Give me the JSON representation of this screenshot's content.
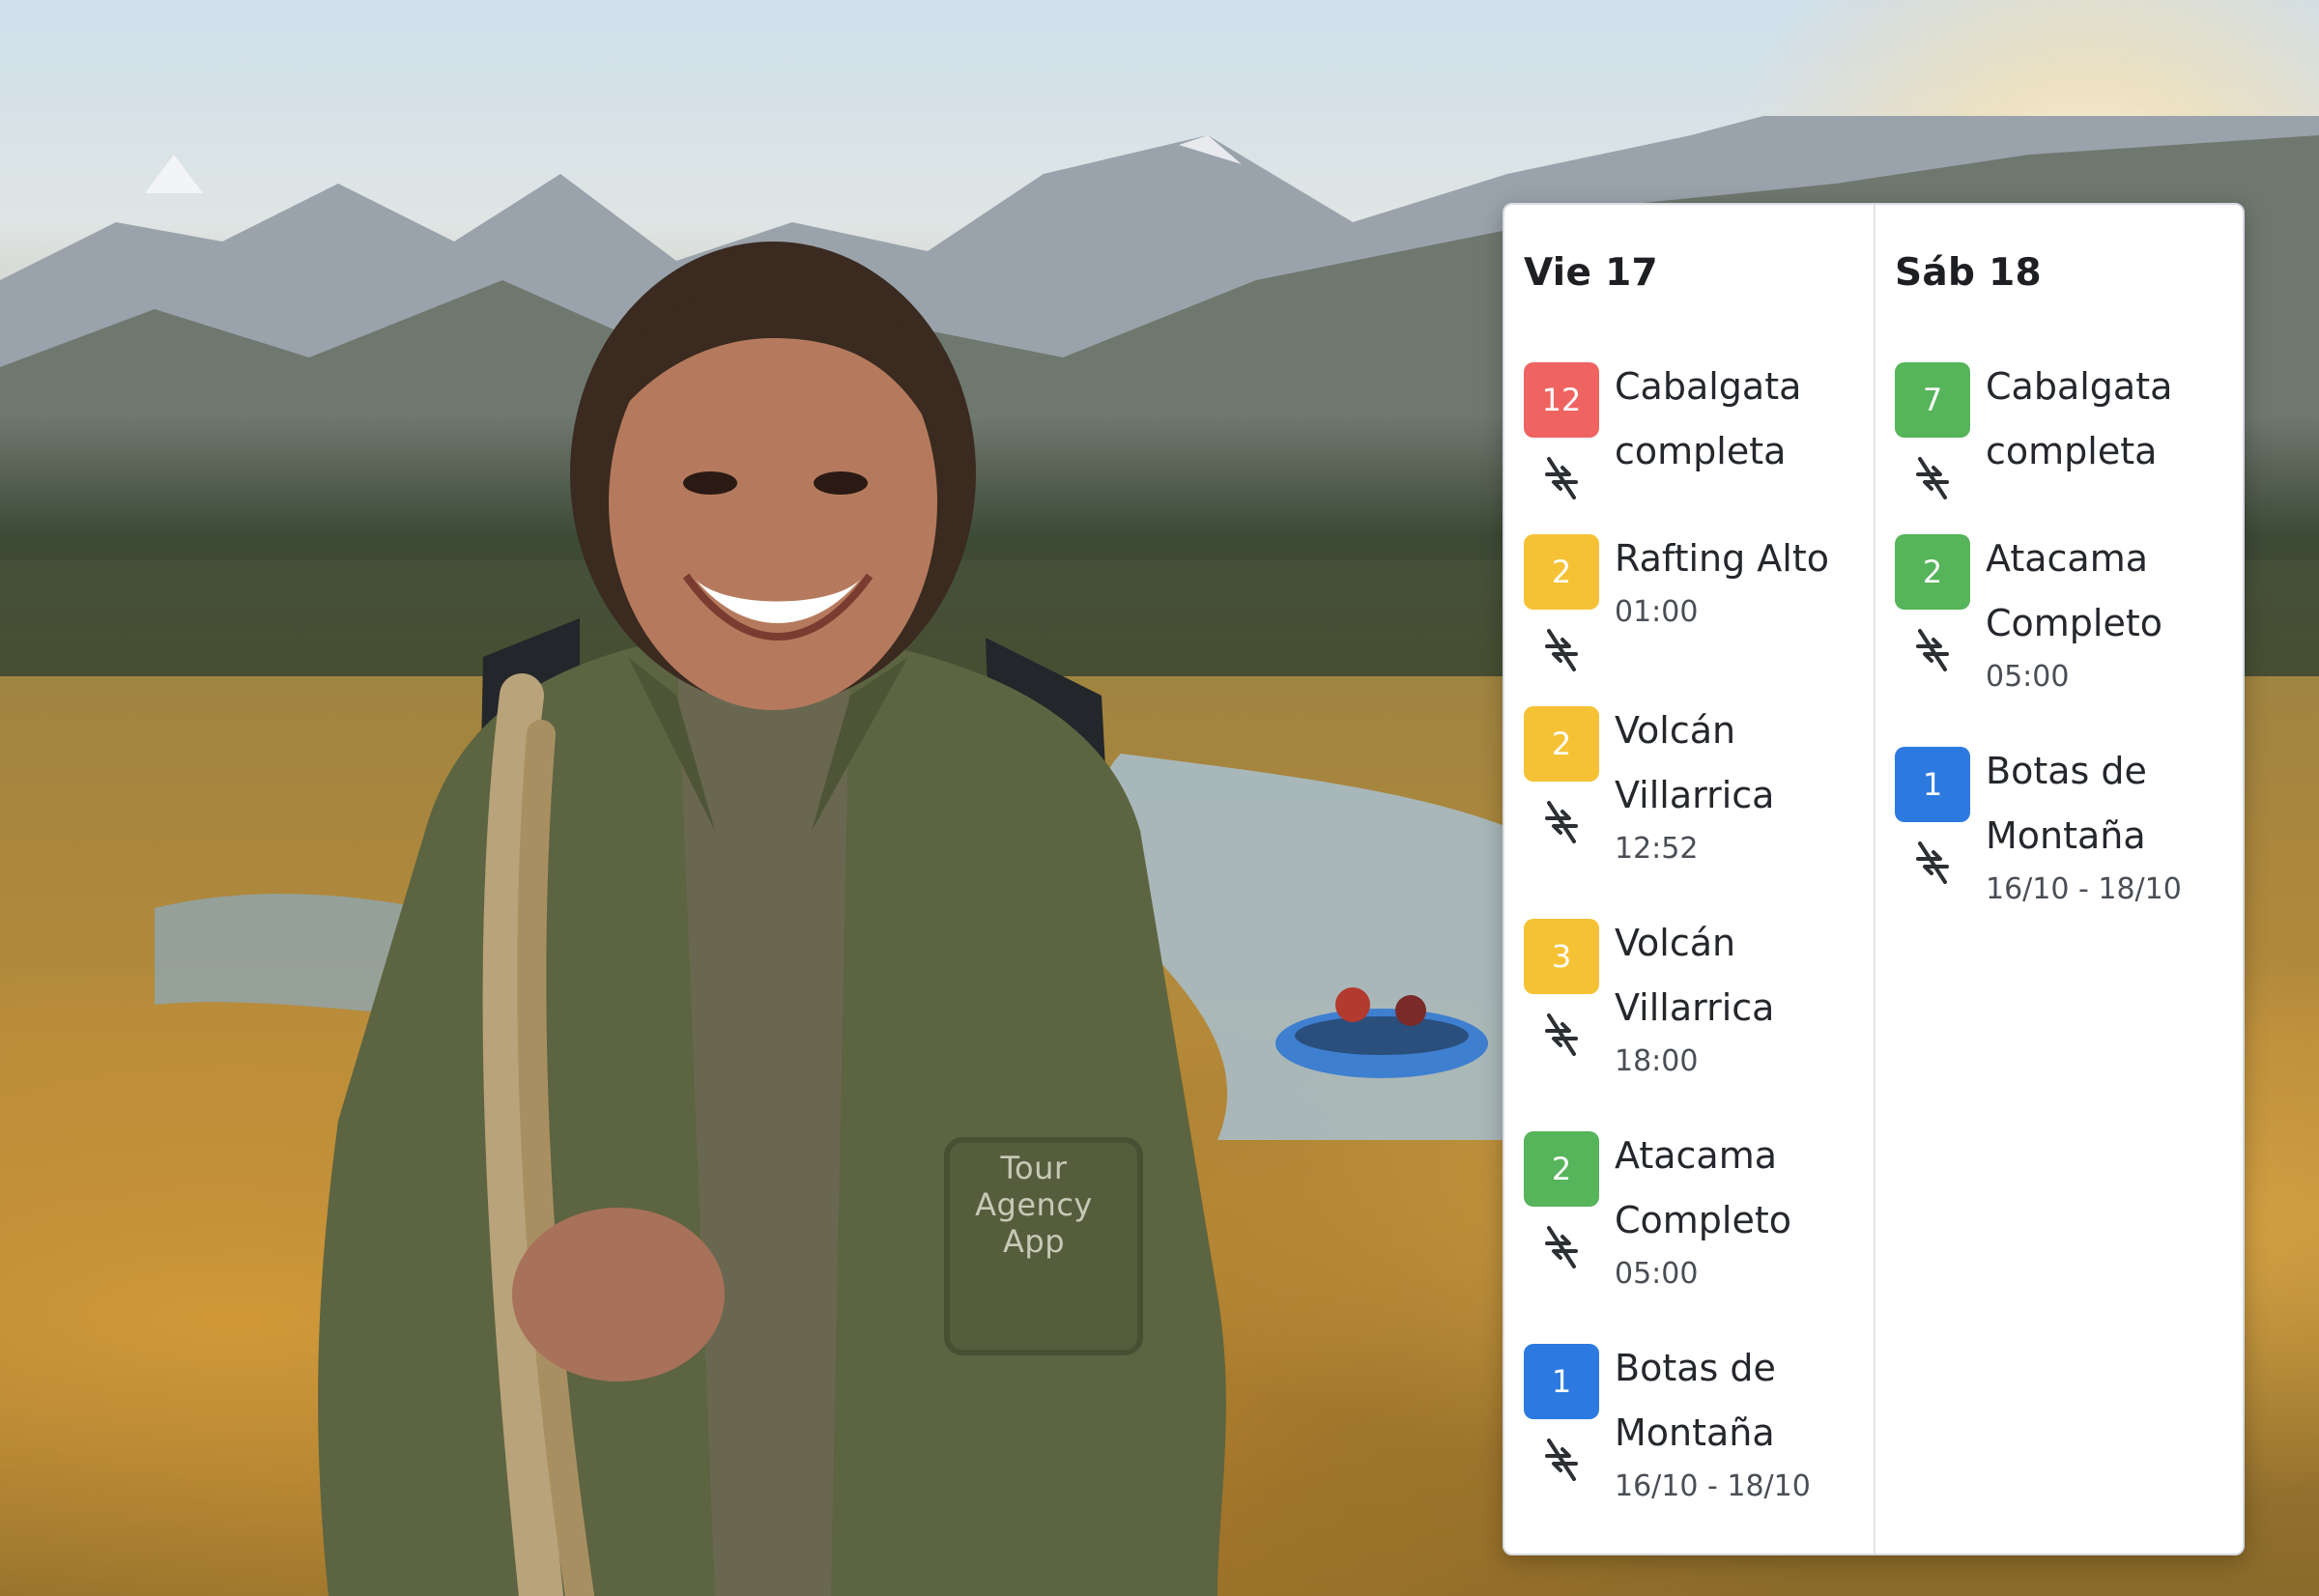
{
  "photo": {
    "jacket_logo": "Tour\nAgency\nApp"
  },
  "calendar": {
    "days": [
      {
        "title": "Vie 17",
        "events": [
          {
            "count": "12",
            "color": "red",
            "name": "Cabalgata completa",
            "time": ""
          },
          {
            "count": "2",
            "color": "yellow",
            "name": "Rafting Alto",
            "time": "01:00"
          },
          {
            "count": "2",
            "color": "yellow",
            "name": "Volcán Villarrica",
            "time": "12:52"
          },
          {
            "count": "3",
            "color": "yellow",
            "name": "Volcán Villarrica",
            "time": "18:00"
          },
          {
            "count": "2",
            "color": "green",
            "name": "Atacama Completo",
            "time": "05:00"
          },
          {
            "count": "1",
            "color": "blue",
            "name": "Botas de Montaña",
            "time": "16/10 - 18/10"
          }
        ]
      },
      {
        "title": "Sáb 18",
        "events": [
          {
            "count": "7",
            "color": "green",
            "name": "Cabalgata completa",
            "time": ""
          },
          {
            "count": "2",
            "color": "green",
            "name": "Atacama Completo",
            "time": "05:00"
          },
          {
            "count": "1",
            "color": "blue",
            "name": "Botas de Montaña",
            "time": "16/10 - 18/10"
          }
        ]
      }
    ],
    "icons": {
      "event_status": "sync-disabled-icon"
    },
    "colors": {
      "red": "#ef6461",
      "yellow": "#f6c235",
      "green": "#56b45a",
      "blue": "#2c7ae0"
    }
  }
}
